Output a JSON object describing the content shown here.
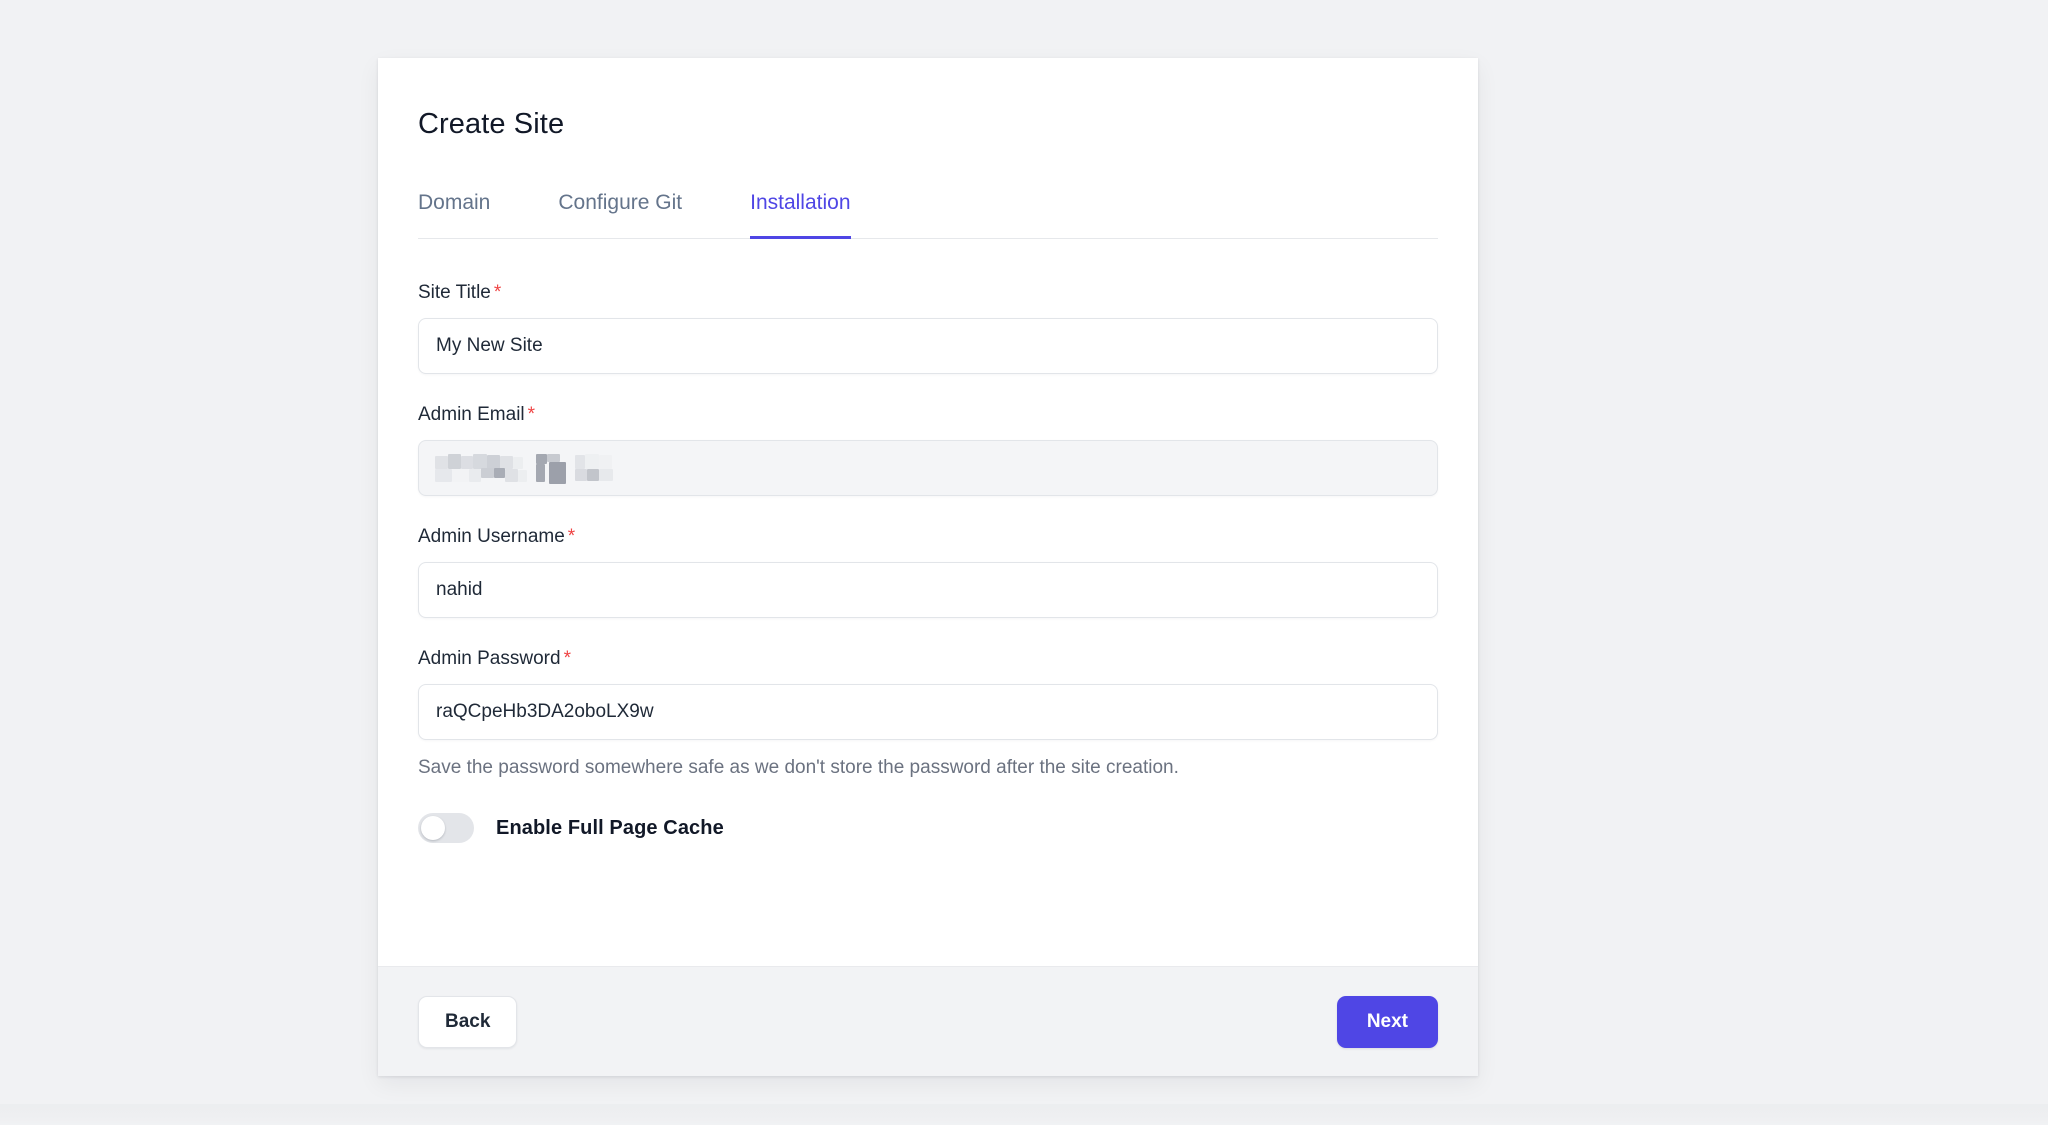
{
  "card": {
    "title": "Create Site"
  },
  "tabs": [
    {
      "label": "Domain",
      "active": false
    },
    {
      "label": "Configure Git",
      "active": false
    },
    {
      "label": "Installation",
      "active": true
    }
  ],
  "form": {
    "site_title": {
      "label": "Site Title",
      "required_marker": "*",
      "value": "My New Site",
      "placeholder": ""
    },
    "admin_email": {
      "label": "Admin Email",
      "required_marker": "*",
      "value": "",
      "placeholder": "",
      "redacted": true
    },
    "admin_username": {
      "label": "Admin Username",
      "required_marker": "*",
      "value": "nahid",
      "placeholder": ""
    },
    "admin_password": {
      "label": "Admin Password",
      "required_marker": "*",
      "value": "raQCpeHb3DA2oboLX9w",
      "placeholder": "",
      "help": "Save the password somewhere safe as we don't store the password after the site creation."
    },
    "full_page_cache": {
      "label": "Enable Full Page Cache",
      "enabled": false
    }
  },
  "footer": {
    "back_label": "Back",
    "next_label": "Next"
  },
  "colors": {
    "accent": "#4F46E5",
    "required": "#EF4444",
    "page_background": "#F1F2F4",
    "card_background": "#FFFFFF",
    "footer_background": "#F2F3F5",
    "muted_text": "#64748B"
  }
}
